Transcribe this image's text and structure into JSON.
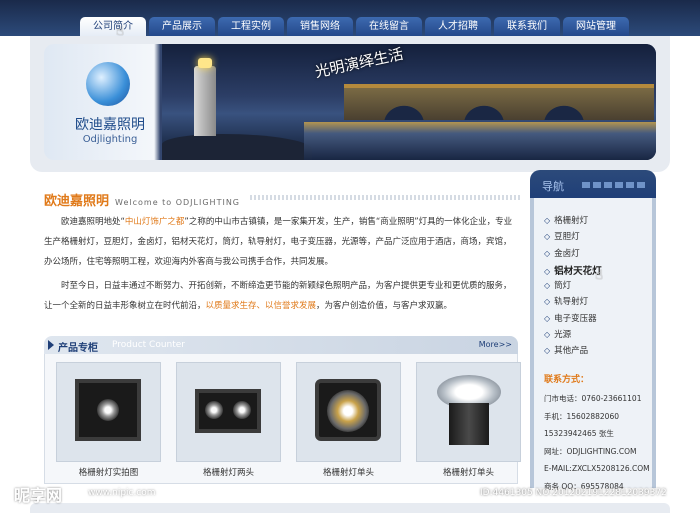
{
  "nav": {
    "tabs": [
      {
        "label": "公司简介",
        "active": true
      },
      {
        "label": "产品展示",
        "active": false
      },
      {
        "label": "工程实例",
        "active": false
      },
      {
        "label": "销售网络",
        "active": false
      },
      {
        "label": "在线留言",
        "active": false
      },
      {
        "label": "人才招聘",
        "active": false
      },
      {
        "label": "联系我们",
        "active": false
      },
      {
        "label": "网站管理",
        "active": false
      }
    ]
  },
  "banner": {
    "logo_cn": "欧迪嘉照明",
    "logo_en": "Odjlighting",
    "slogan": "光明演绎生活"
  },
  "intro": {
    "title_cn": "欧迪嘉照明",
    "title_en": "Welcome to ODJLIGHTING",
    "para1_a": "欧迪嘉照明地处“",
    "para1_link": "中山灯饰广之都",
    "para1_b": "”之称的中山市古镇镇，是一家集开发，生产，销售“商业照明”灯具的一体化企业，专业生产格栅射灯，豆胆灯，金卤灯，铝材天花灯，筒灯，轨导射灯，电子变压器，光源等，产品广泛应用于酒店，商场，宾馆，办公场所，住宅等照明工程，欢迎海内外客商与我公司携手合作，共同发展。",
    "para2_a": "时至今日，日益丰通过不断努力、开拓创新，不断缔造更节能的新颖绿色照明产品，为客户提供更专业和更优质的服务，让一个全新的日益丰形象树立在时代前沿，",
    "para2_link": "以质量求生存、以信誉求发展",
    "para2_b": "，为客户创造价值，与客户求双赢。"
  },
  "products": {
    "title": "产品专柜",
    "title_en": "Product Counter",
    "more": "More>>",
    "items": [
      {
        "label": "格栅射灯实拍图"
      },
      {
        "label": "格栅射灯两头"
      },
      {
        "label": "格栅射灯单头"
      },
      {
        "label": "格栅射灯单头"
      }
    ]
  },
  "sidebar": {
    "title": "导航",
    "items": [
      {
        "label": "格栅射灯"
      },
      {
        "label": "豆胆灯"
      },
      {
        "label": "金卤灯"
      },
      {
        "label": "铝材天花灯",
        "hover": true
      },
      {
        "label": "筒灯"
      },
      {
        "label": "轨导射灯"
      },
      {
        "label": "电子变压器"
      },
      {
        "label": "光源"
      },
      {
        "label": "其他产品"
      }
    ],
    "contact": {
      "title": "联系方式：",
      "lines": [
        "门市电话：0760-23661101",
        "手机：15602882060",
        "15323942465    张生",
        "网址：ODJLIGHTING.COM",
        "E-MAIL:ZXCLX5208126.COM",
        "商务 QQ：695578084"
      ]
    }
  },
  "watermark": {
    "site": "昵享网",
    "url": "www.nipic.com",
    "id": "ID:4461305 NO:20120219122812039372"
  },
  "colors": {
    "nav_bg": "#24488a",
    "accent_orange": "#e07a1a",
    "brand_blue": "#1f3f78"
  }
}
